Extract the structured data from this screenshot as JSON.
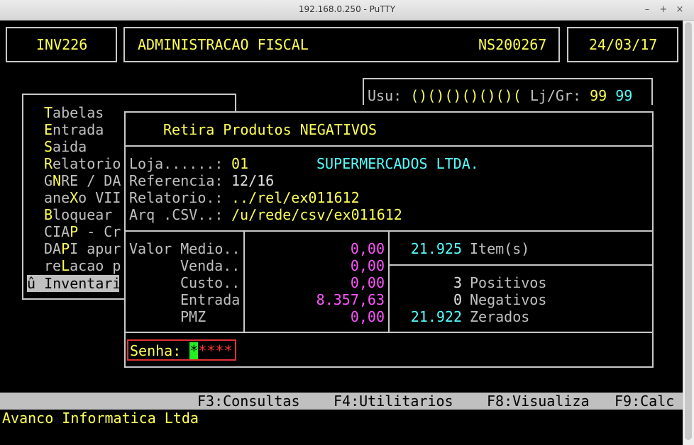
{
  "window": {
    "title": "192.168.0.250 - PuTTY",
    "minimize": "–",
    "maximize": "+",
    "close": "×"
  },
  "header": {
    "program": "INV226",
    "system": "ADMINISTRACAO FISCAL",
    "code": "NS200267",
    "date": "24/03/17"
  },
  "user": {
    "label": "Usu:",
    "value": "()()()()()()(",
    "lj_label": "Lj/Gr:",
    "lj": "99",
    "gr": "99"
  },
  "menu": {
    "items": [
      {
        "hot": "T",
        "rest": "abelas"
      },
      {
        "hot": "E",
        "rest": "ntrada"
      },
      {
        "hot": "S",
        "rest": "aida"
      },
      {
        "hot": "R",
        "rest": "elatorio"
      },
      {
        "pre": "G",
        "hot": "N",
        "rest": "RE / DA"
      },
      {
        "pre": "ane",
        "hot": "X",
        "rest": "o VII"
      },
      {
        "hot": "B",
        "rest": "loquear"
      },
      {
        "pre": "CIA",
        "hot": "P",
        "rest": " - Cr"
      },
      {
        "pre": "DA",
        "hot": "P",
        "rest": "I apur"
      },
      {
        "pre": "re",
        "hot": "L",
        "rest": "acao p"
      }
    ],
    "selected": "û Inventari"
  },
  "dialog": {
    "title": "Retira Produtos NEGATIVOS",
    "loja_label": "Loja......:",
    "loja": "01",
    "loja_name": "SUPERMERCADOS LTDA.",
    "ref_label": "Referencia:",
    "ref": "12/16",
    "rel_label": "Relatorio.:",
    "rel": "../rel/ex011612",
    "csv_label": "Arq .CSV..:",
    "csv": "/u/rede/csv/ex011612",
    "valor_label": "Valor Medio..",
    "venda_label": "Venda..",
    "custo_label": "Custo..",
    "entrada_label": "Entrada",
    "pmz_label": "PMZ",
    "valor": "0,00",
    "venda": "0,00",
    "custo": "0,00",
    "entrada": "8.357,63",
    "pmz": "0,00",
    "itens_count": "21.925",
    "itens_label": "Item(s)",
    "pos_count": "3",
    "pos_label": "Positivos",
    "neg_count": "0",
    "neg_label": "Negativos",
    "zer_count": "21.922",
    "zer_label": "Zerados",
    "senha_label": "Senha:",
    "senha_cursor": "*",
    "senha_rest": "****"
  },
  "fkeys": {
    "f3": "F3:Consultas",
    "f4": "F4:Utilitarios",
    "f8": "F8:Visualiza",
    "f9": "F9:Calc"
  },
  "footer": {
    "company": "Avanco Informatica Ltda"
  },
  "colors": {
    "yellow": "#ffff55",
    "cyan": "#55ffff",
    "magenta": "#ff55ff",
    "cursor": "#22ee22",
    "senha_frame": "#e03030"
  }
}
